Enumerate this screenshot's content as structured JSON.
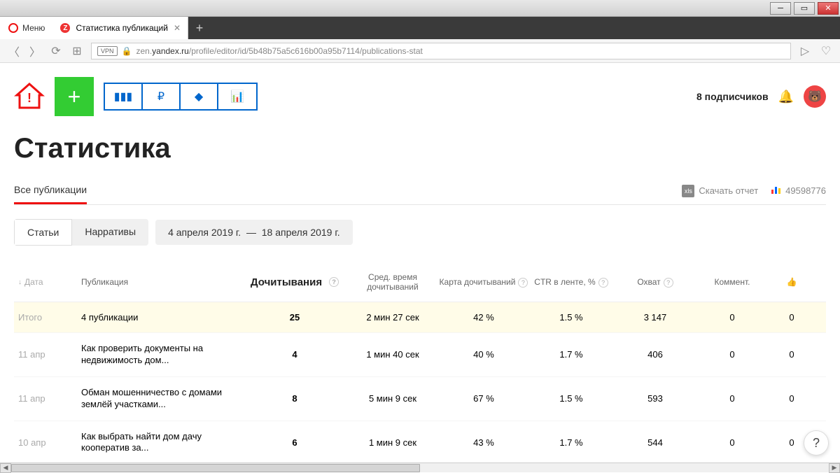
{
  "browser": {
    "menu_label": "Меню",
    "tab_title": "Статистика публикаций",
    "url_prefix": "zen.",
    "url_domain": "yandex.ru",
    "url_path": "/profile/editor/id/5b48b75a5c616b00a95b7114/publications-stat",
    "vpn": "VPN"
  },
  "header": {
    "subscribers": "8 подписчиков",
    "metrika_id": "49598776"
  },
  "page_title": "Статистика",
  "subnav": {
    "tab_all": "Все публикации",
    "download": "Скачать отчет"
  },
  "filters": {
    "tab_articles": "Статьи",
    "tab_narratives": "Нарративы",
    "date_from": "4 апреля 2019 г.",
    "date_to": "18 апреля 2019 г."
  },
  "columns": {
    "date": "Дата",
    "publication": "Публикация",
    "reads": "Дочитывания",
    "avg_time": "Сред. время дочитываний",
    "map": "Карта дочитываний",
    "ctr": "CTR в ленте, %",
    "reach": "Охват",
    "comments": "Коммент."
  },
  "totals": {
    "label": "Итого",
    "publication": "4 публикации",
    "reads": "25",
    "avg_time": "2 мин 27 сек",
    "map": "42 %",
    "ctr": "1.5 %",
    "reach": "3 147",
    "comments": "0",
    "likes": "0"
  },
  "rows": [
    {
      "date": "11 апр",
      "publication": "Как проверить документы на недвижимость дом...",
      "reads": "4",
      "avg_time": "1 мин 40 сек",
      "map": "40 %",
      "ctr": "1.7 %",
      "reach": "406",
      "comments": "0",
      "likes": "0"
    },
    {
      "date": "11 апр",
      "publication": "Обман мошенничество с домами землёй участками...",
      "reads": "8",
      "avg_time": "5 мин 9 сек",
      "map": "67 %",
      "ctr": "1.5 %",
      "reach": "593",
      "comments": "0",
      "likes": "0"
    },
    {
      "date": "10 апр",
      "publication": "Как выбрать найти дом дачу кооператив за...",
      "reads": "6",
      "avg_time": "1 мин 9 сек",
      "map": "43 %",
      "ctr": "1.7 %",
      "reach": "544",
      "comments": "0",
      "likes": "0"
    }
  ]
}
